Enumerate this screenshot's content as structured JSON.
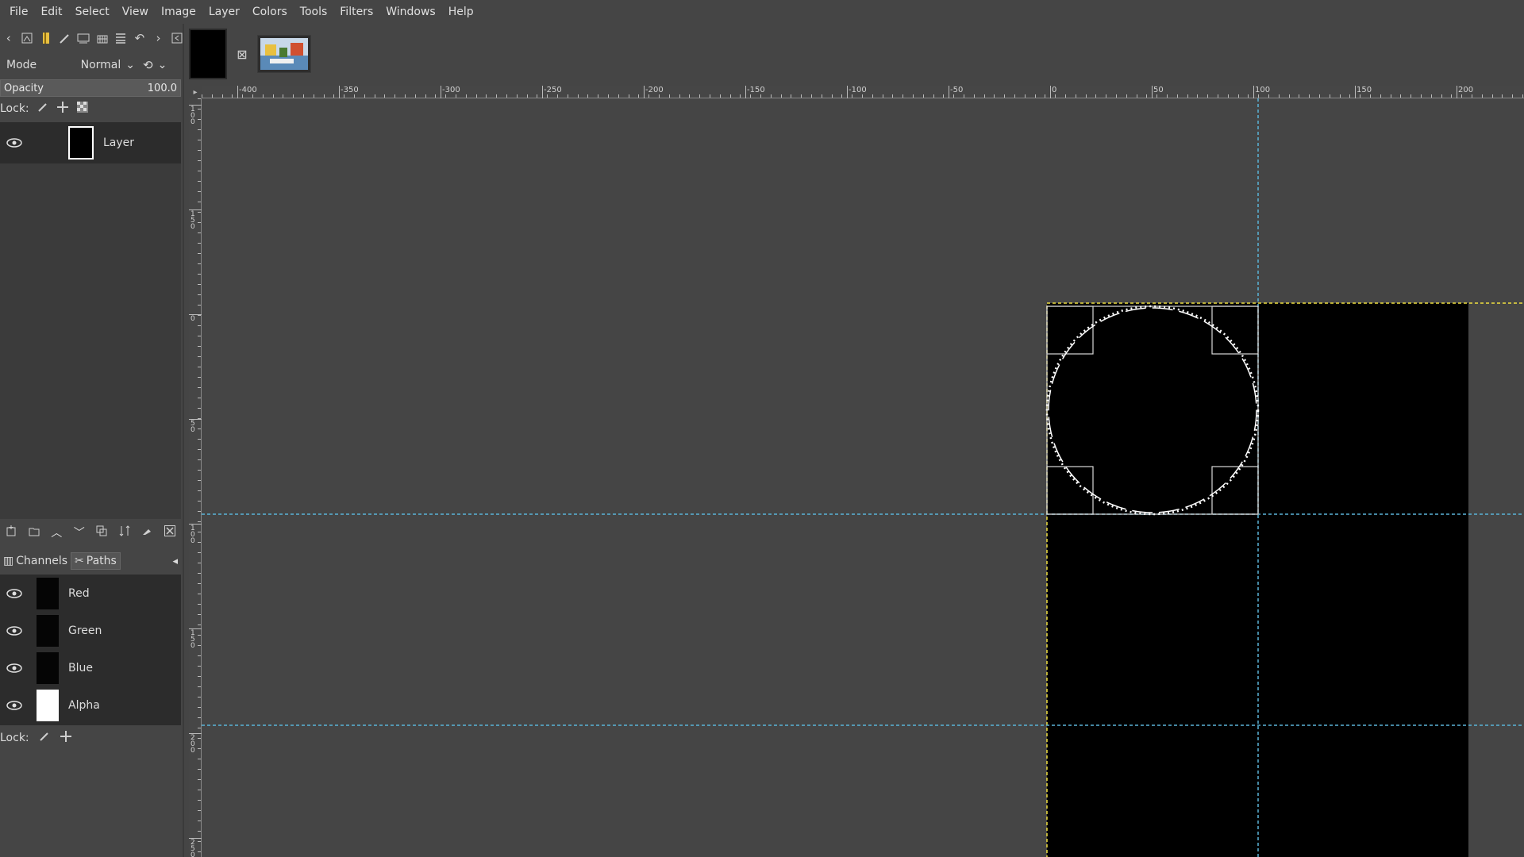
{
  "menu": [
    "File",
    "Edit",
    "Select",
    "View",
    "Image",
    "Layer",
    "Colors",
    "Tools",
    "Filters",
    "Windows",
    "Help"
  ],
  "layers_panel": {
    "mode_label": "Mode",
    "mode_value": "Normal",
    "opacity_label": "Opacity",
    "opacity_value": "100.0",
    "lock_label": "Lock:",
    "layer_name": "Layer"
  },
  "channels_panel": {
    "tab_channels": "Channels",
    "tab_paths": "Paths",
    "channels": [
      "Red",
      "Green",
      "Blue",
      "Alpha"
    ],
    "lock_label": "Lock:"
  },
  "ruler": {
    "h_labels": [
      "-400",
      "-350",
      "-300",
      "-250",
      "-200",
      "-150",
      "-100",
      "-50",
      "0",
      "50",
      "100",
      "150",
      "200"
    ],
    "v_labels": [
      "100",
      "150",
      "0",
      "50",
      "100",
      "150",
      "200",
      "250"
    ]
  },
  "colors": {
    "guide": "#5ab4d8",
    "image_boundary": "#f0e040",
    "canvas_bg": "#454545",
    "image_fill": "#000000"
  },
  "icons": [
    "left-arrow-icon",
    "images-icon",
    "brushes-icon",
    "pencil-icon",
    "document-icon",
    "grid-icon",
    "list-icon",
    "undo-icon",
    "right-arrow-icon",
    "config-icon"
  ]
}
